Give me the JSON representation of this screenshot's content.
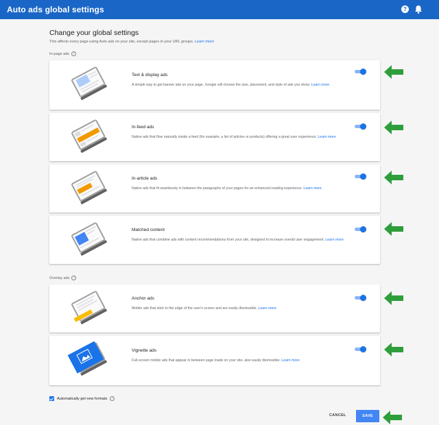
{
  "header": {
    "title": "Auto ads global settings",
    "help_icon_glyph": "?",
    "bg_color": "#1a66c7"
  },
  "page": {
    "heading": "Change your global settings",
    "subtitle": "This affects every page using Auto ads on your site, except pages in your URL groups.",
    "subtitle_link": "Learn more"
  },
  "sections": {
    "in_page_label": "In-page ads",
    "overlay_label": "Overlay ads"
  },
  "cards": [
    {
      "title": "Text & display ads",
      "desc": "A simple way to get banner ads on your page. Google will choose the size, placement, and style of ads you show.",
      "link": "Learn more",
      "enabled": true,
      "illustration": "text-display-icon"
    },
    {
      "title": "In-feed ads",
      "desc": "Native ads that flow naturally inside a feed (for example, a list of articles or products) offering a great user experience.",
      "link": "Learn more",
      "enabled": true,
      "illustration": "in-feed-icon"
    },
    {
      "title": "In-article ads",
      "desc": "Native ads that fit seamlessly in between the paragraphs of your pages for an enhanced reading experience.",
      "link": "Learn more",
      "enabled": true,
      "illustration": "in-article-icon"
    },
    {
      "title": "Matched content",
      "desc": "Native ads that combine ads with content recommendations from your site, designed to increase overall user engagement.",
      "link": "Learn more",
      "enabled": true,
      "illustration": "matched-content-icon"
    },
    {
      "title": "Anchor ads",
      "desc": "Mobile ads that stick to the edge of the user's screen and are easily dismissible.",
      "link": "Learn more",
      "enabled": true,
      "illustration": "anchor-icon"
    },
    {
      "title": "Vignette ads",
      "desc": "Full-screen mobile ads that appear in between page loads on your site, also easily dismissible.",
      "link": "Learn more",
      "enabled": true,
      "illustration": "vignette-icon"
    }
  ],
  "footer": {
    "auto_formats_label": "Automatically get new formats",
    "auto_formats_checked": true,
    "cancel_label": "CANCEL",
    "save_label": "SAVE"
  },
  "colors": {
    "accent": "#1a73e8",
    "arrow": "#2e9e3c",
    "save": "#4285f4"
  }
}
